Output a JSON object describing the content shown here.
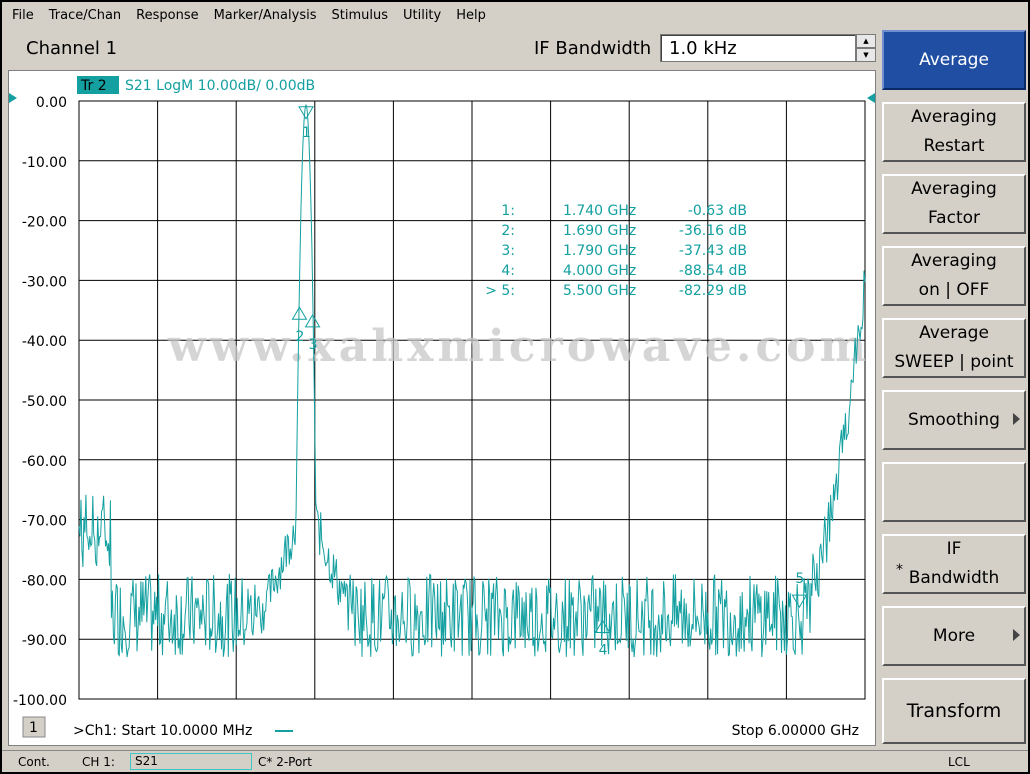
{
  "menu": [
    "File",
    "Trace/Chan",
    "Response",
    "Marker/Analysis",
    "Stimulus",
    "Utility",
    "Help"
  ],
  "channel": {
    "title": "Channel 1",
    "ifbw_label": "IF Bandwidth",
    "ifbw_value": "1.0 kHz"
  },
  "trace": {
    "tag": "Tr 2",
    "label": "S21 LogM 10.00dB/  0.00dB",
    "color": "#14a0a0"
  },
  "chart_data": {
    "type": "line",
    "series": [
      {
        "name": "S21",
        "peak_freq_ghz": 1.74
      }
    ],
    "xlim": [
      0.01,
      6.0
    ],
    "ylim": [
      -100,
      0
    ],
    "yticks": [
      "0.00",
      "-10.00",
      "-20.00",
      "-30.00",
      "-40.00",
      "-50.00",
      "-60.00",
      "-70.00",
      "-80.00",
      "-90.00",
      "-100.00"
    ],
    "grid": true,
    "start_label": ">Ch1: Start  10.0000 MHz",
    "stop_label": "Stop  6.00000 GHz",
    "channel_box": "1",
    "markers": [
      {
        "id": "1",
        "label": "1:",
        "freq": "1.740 GHz",
        "value": "-0.63 dB",
        "f": 1.74,
        "db": -0.63
      },
      {
        "id": "2",
        "label": "2:",
        "freq": "1.690 GHz",
        "value": "-36.16 dB",
        "f": 1.69,
        "db": -36.16
      },
      {
        "id": "3",
        "label": "3:",
        "freq": "1.790 GHz",
        "value": "-37.43 dB",
        "f": 1.79,
        "db": -37.43
      },
      {
        "id": "4",
        "label": "4:",
        "freq": "4.000 GHz",
        "value": "-88.54 dB",
        "f": 4.0,
        "db": -88.54
      },
      {
        "id": "5",
        "label": "> 5:",
        "freq": "5.500 GHz",
        "value": "-82.29 dB",
        "f": 5.5,
        "db": -82.29
      }
    ]
  },
  "watermark": "www.xahxmicrowave.com",
  "softkeys": [
    {
      "line1": "Average",
      "line2": "",
      "active": true
    },
    {
      "line1": "Averaging",
      "line2": "Restart"
    },
    {
      "line1": "Averaging",
      "line2": "Factor"
    },
    {
      "line1": "Averaging",
      "line2": "on | OFF"
    },
    {
      "line1": "Average",
      "line2": "SWEEP | point"
    },
    {
      "line1": "Smoothing",
      "line2": "",
      "arrow": true
    },
    {
      "line1": "",
      "line2": ""
    },
    {
      "line1": "IF",
      "line2": "Bandwidth",
      "star": true
    },
    {
      "line1": "More",
      "line2": "",
      "arrow": true
    },
    {
      "line1": "Transform",
      "line2": ""
    }
  ],
  "status": {
    "mode": "Cont.",
    "channel": "CH 1:",
    "param": "S21",
    "cal": "C* 2-Port",
    "lcl": "LCL"
  }
}
